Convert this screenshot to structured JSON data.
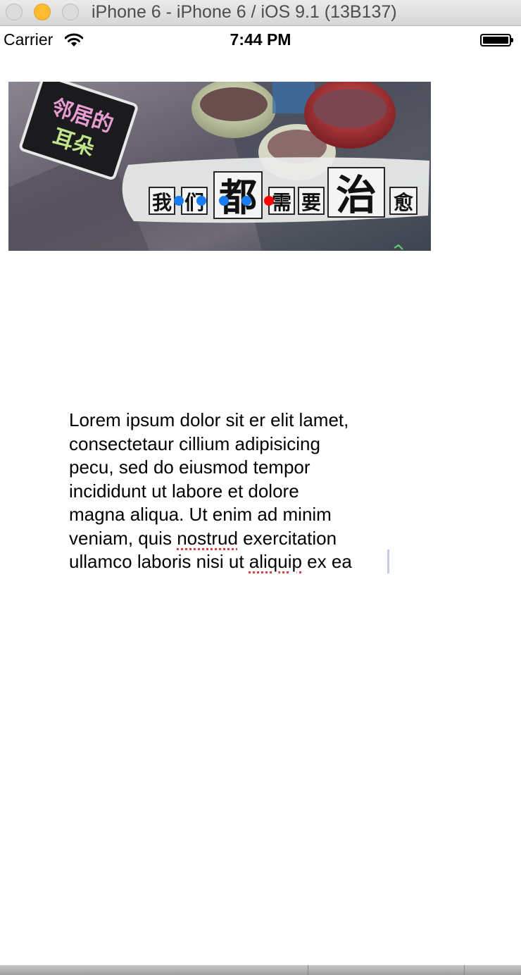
{
  "window": {
    "title": "iPhone 6 - iPhone 6 / iOS 9.1 (13B137)"
  },
  "status_bar": {
    "carrier": "Carrier",
    "time": "7:44 PM",
    "wifi_icon": "wifi-icon",
    "battery_icon": "battery-full-icon"
  },
  "banner": {
    "logo_text_line1": "邻居的",
    "logo_text_line2": "耳朵",
    "slogan_chars": [
      "我",
      "们",
      "都",
      "需",
      "要",
      "治",
      "愈"
    ],
    "page_indicator": {
      "count": 5,
      "current_index": 4,
      "dot_color": "#1a7cf0",
      "current_color": "#ff0000"
    }
  },
  "text_view": {
    "lines": [
      "Lorem ipsum dolor sit er elit lamet,",
      "consectetaur cillium adipisicing",
      "pecu, sed do eiusmod tempor",
      "incididunt ut labore et dolore",
      "magna aliqua. Ut enim ad minim"
    ],
    "line6": {
      "before": "veniam, quis ",
      "misspelled": "nostrud",
      "after": " exercitation"
    },
    "line7": {
      "before": "ullamco laboris nisi ut ",
      "misspelled": "aliquip",
      "after": " ex ea"
    }
  }
}
